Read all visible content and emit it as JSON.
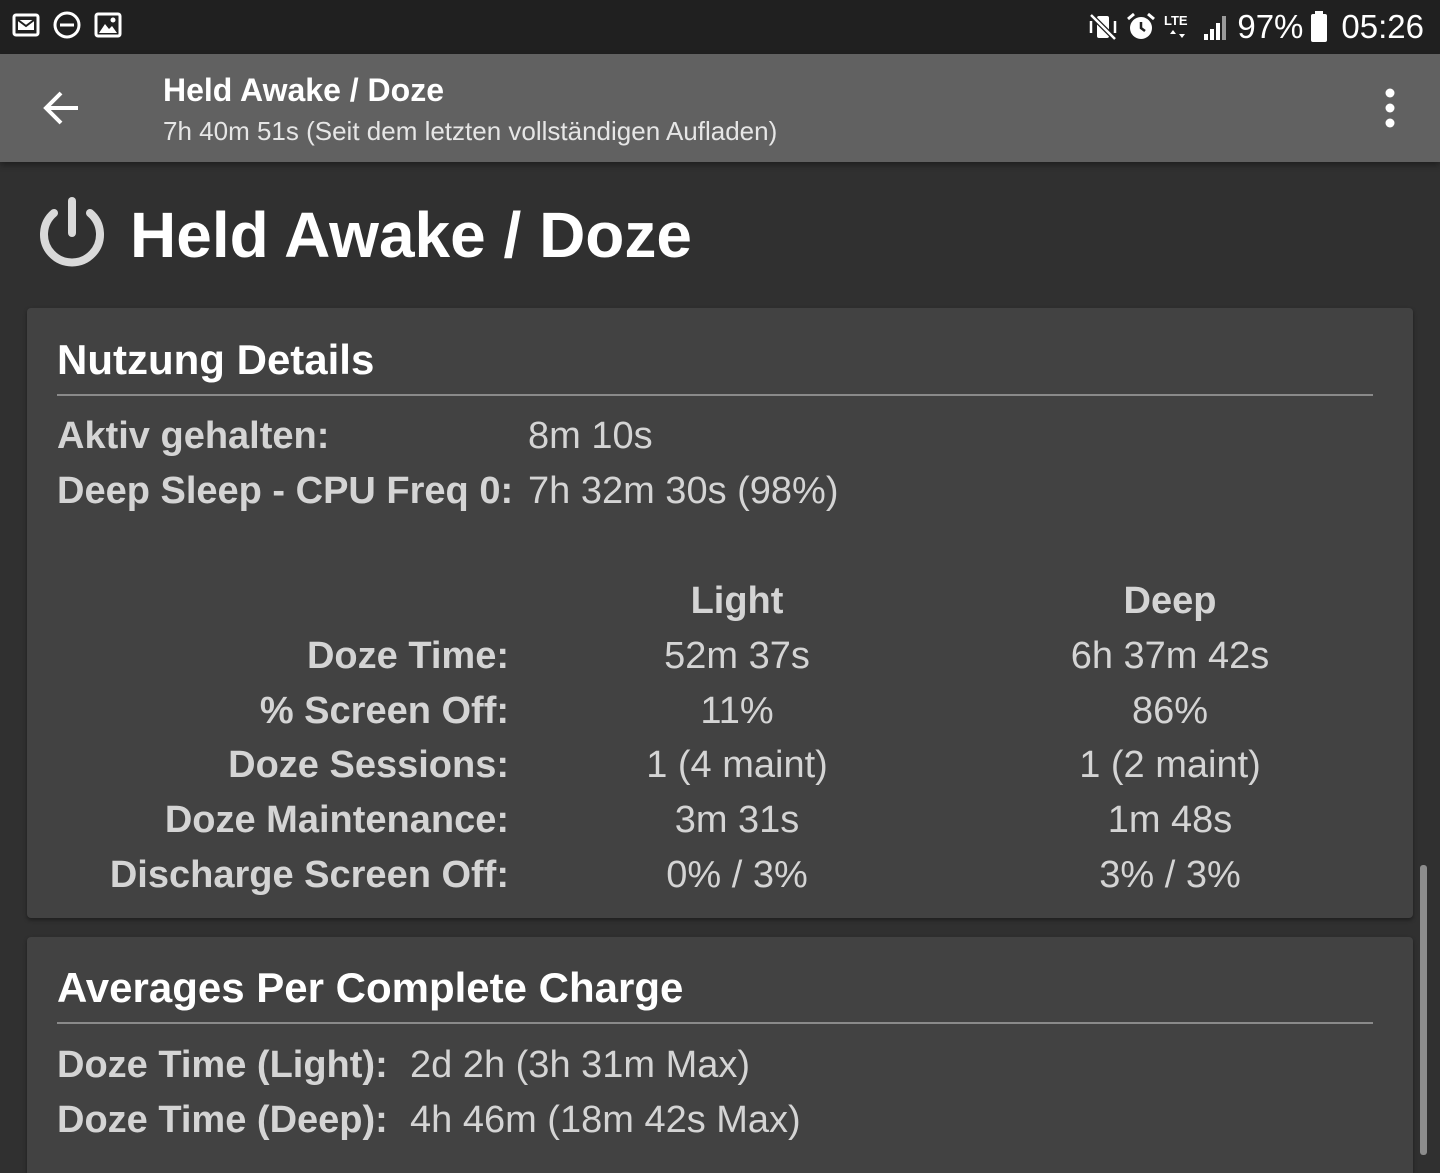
{
  "status_bar": {
    "battery": "97%",
    "time": "05:26",
    "network": "LTE",
    "left_icons": [
      "email-notification-icon",
      "do-not-disturb-icon",
      "image-icon"
    ],
    "right_icons": [
      "vibrate-mute-icon",
      "alarm-icon",
      "lte-icon",
      "signal-icon",
      "battery-icon"
    ]
  },
  "appbar": {
    "title": "Held Awake / Doze",
    "subtitle": "7h 40m 51s (Seit dem letzten vollständigen Aufladen)",
    "back_icon": "arrow-back-icon",
    "menu_icon": "more-vertical-icon"
  },
  "header": {
    "icon": "power-icon",
    "title": "Held Awake / Doze"
  },
  "usage": {
    "title": "Nutzung Details",
    "awake_label": "Aktiv gehalten:",
    "awake_value": "8m 10s",
    "deep_sleep_label": "Deep Sleep - CPU Freq 0:",
    "deep_sleep_value": "7h 32m 30s (98%)",
    "columns": [
      "Light",
      "Deep"
    ],
    "rows": [
      {
        "label": "Doze Time:",
        "light": "52m 37s",
        "deep": "6h 37m 42s"
      },
      {
        "label": "% Screen Off:",
        "light": "11%",
        "deep": "86%"
      },
      {
        "label": "Doze Sessions:",
        "light": "1 (4 maint)",
        "deep": "1 (2 maint)"
      },
      {
        "label": "Doze Maintenance:",
        "light": "3m 31s",
        "deep": "1m 48s"
      },
      {
        "label": "Discharge Screen Off:",
        "light": "0% / 3%",
        "deep": "3% / 3%"
      }
    ]
  },
  "averages": {
    "title": "Averages Per Complete Charge",
    "items": [
      {
        "label": "Doze Time (Light):",
        "value": "2d 2h (3h 31m Max)"
      },
      {
        "label": "Doze Time (Deep):",
        "value": "4h 46m (18m 42s Max)"
      }
    ]
  },
  "colors": {
    "background": "#303030",
    "card": "#424242",
    "appbar": "#616161",
    "statusbar": "#202020",
    "text": "#d4d4d4"
  }
}
